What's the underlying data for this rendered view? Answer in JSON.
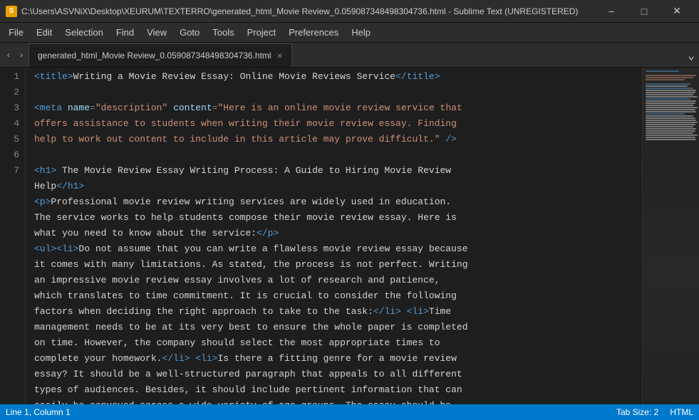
{
  "titlebar": {
    "icon": "S",
    "title": "C:\\Users\\ASVNiX\\Desktop\\XEURUM\\TEXTERRO\\generated_html_Movie Review_0.059087348498304736.html - Sublime Text (UNREGISTERED)",
    "minimize": "−",
    "maximize": "□",
    "close": "✕"
  },
  "menubar": {
    "items": [
      "File",
      "Edit",
      "Selection",
      "Find",
      "View",
      "Goto",
      "Tools",
      "Project",
      "Preferences",
      "Help"
    ]
  },
  "tabbar": {
    "tab_label": "generated_html_Movie Review_0.059087348498304736.html",
    "tab_close": "×",
    "arrow_left": "‹",
    "arrow_right": "›",
    "chevron": "⌄"
  },
  "editor": {
    "lines": [
      {
        "num": "1",
        "content": "<title>Writing a Movie Review Essay: Online Movie Reviews Service</title>"
      },
      {
        "num": "2",
        "content": ""
      },
      {
        "num": "3",
        "content": "<meta name=\"description\" content=\"Here is an online movie review service that offers assistance to students when writing their movie review essay. Finding help to work out content to include in this article may prove difficult.\" />"
      },
      {
        "num": "4",
        "content": ""
      },
      {
        "num": "5",
        "content": "<h1> The Movie Review Essay Writing Process: A Guide to Hiring Movie Review Help</h1>"
      },
      {
        "num": "6",
        "content": "<p>Professional movie review writing services are widely used in education. The service works to help students compose their movie review essay. Here is what you need to know about the service:</p>"
      },
      {
        "num": "7",
        "content": "<ul><li>Do not assume that you can write a flawless movie review essay because it comes with many limitations. As stated, the process is not perfect. Writing an impressive movie review essay involves a lot of research and patience, which translates to time commitment. It is crucial to consider the following factors when deciding the right approach to take to the task:</li> <li>Time management needs to be at its very best to ensure the whole paper is completed on time. However, the company should select the most appropriate times to complete your homework.</li> <li>Is there a fitting genre for a movie review essay? It should be a well-structured paragraph that appeals to all different types of audiences. Besides, it should include pertinent information that can easily be conveyed across a wide variety of age groups. The essay should be"
      }
    ]
  },
  "statusbar": {
    "position": "Line 1, Column 1",
    "tab_size": "Tab Size: 2",
    "syntax": "HTML"
  }
}
